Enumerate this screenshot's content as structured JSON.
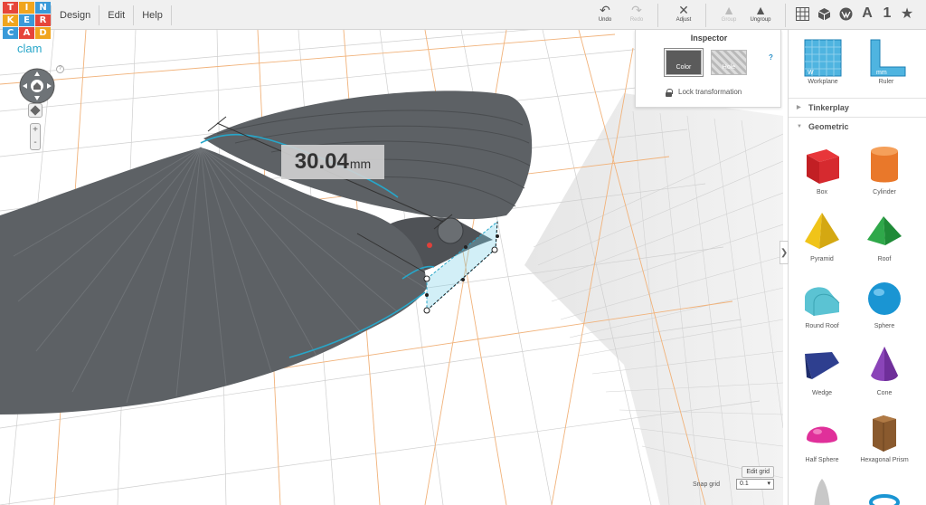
{
  "app": {
    "logo_letters": [
      "T",
      "I",
      "N",
      "K",
      "E",
      "R",
      "C",
      "A",
      "D"
    ],
    "logo_colors": [
      "#e6453a",
      "#f0a51e",
      "#3a9ad9",
      "#e6453a",
      "#f0a51e",
      "#3a9ad9",
      "#e6453a",
      "#f0a51e",
      "#3a9ad9"
    ]
  },
  "menu": [
    "Design",
    "Edit",
    "Help"
  ],
  "toolbar": {
    "undo": "Undo",
    "redo": "Redo",
    "adjust": "Adjust",
    "group": "Group",
    "ungroup": "Ungroup",
    "view_icons": [
      "grid-icon",
      "cube-icon",
      "solid-icon"
    ],
    "text_icon": "A",
    "number_icon": "1",
    "star_icon": "★"
  },
  "project": {
    "name": "clam"
  },
  "viewport": {
    "nav_help": "?",
    "zoom_in": "+",
    "zoom_out": "-",
    "dimension_value": "30.04",
    "dimension_unit": "mm",
    "object_color": "#5d6165",
    "highlight_color": "#27a6c9"
  },
  "inspector": {
    "title": "Inspector",
    "color_label": "Color",
    "hole_label": "Hole",
    "help": "?",
    "lock_label": "Lock transformation"
  },
  "grid": {
    "edit_grid": "Edit grid",
    "snap_label": "Snap grid",
    "snap_value": "0.1"
  },
  "panel": {
    "collapse": "❯",
    "tools": [
      "Workplane",
      "Ruler"
    ],
    "sections": [
      {
        "name": "Tinkerplay",
        "expanded": false
      },
      {
        "name": "Geometric",
        "expanded": true
      }
    ],
    "shapes": [
      "Box",
      "Cylinder",
      "Pyramid",
      "Roof",
      "Round Roof",
      "Sphere",
      "Wedge",
      "Cone",
      "Half Sphere",
      "Hexagonal Prism"
    ]
  }
}
